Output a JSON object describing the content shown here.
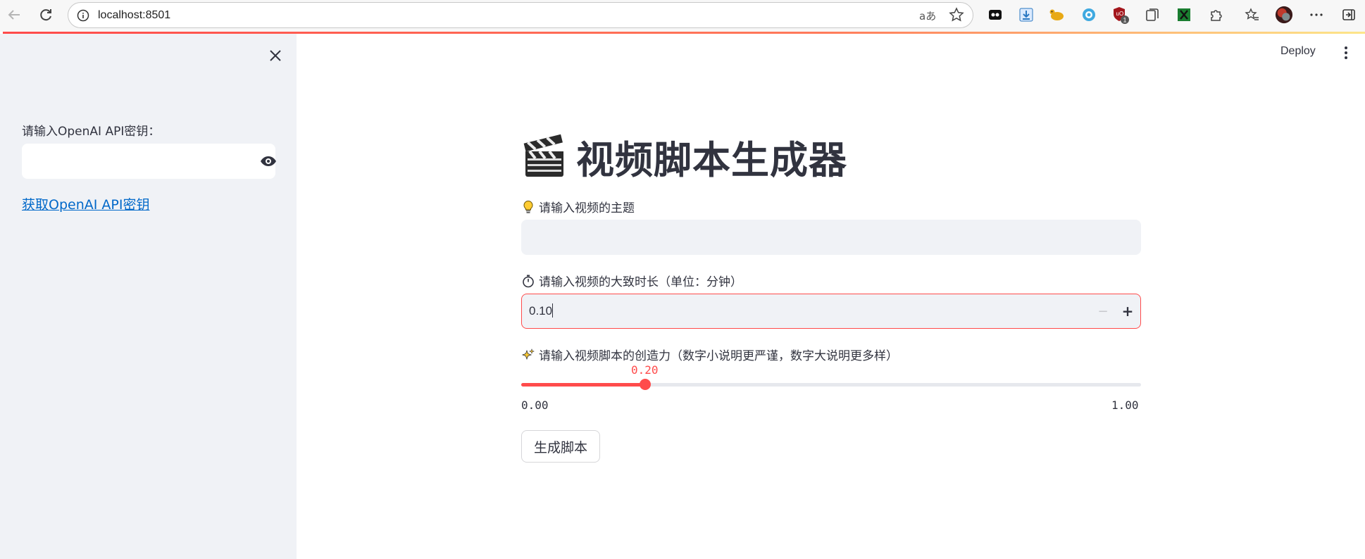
{
  "browser": {
    "url": "localhost:8501",
    "ext_badge": "1"
  },
  "sidebar": {
    "api_key_label": "请输入OpenAI API密钥：",
    "api_key_value": "",
    "get_key_link": "获取OpenAI API密钥"
  },
  "header": {
    "deploy_label": "Deploy"
  },
  "main": {
    "title": "视频脚本生成器",
    "subject": {
      "label": "请输入视频的主题",
      "value": ""
    },
    "duration": {
      "label": "请输入视频的大致时长（单位：分钟）",
      "value": "0.10",
      "minus": "−",
      "plus": "+"
    },
    "creativity": {
      "label": "请输入视频脚本的创造力（数字小说明更严谨，数字大说明更多样）",
      "value": 0.2,
      "value_label": "0.20",
      "min_label": "0.00",
      "max_label": "1.00",
      "min": 0,
      "max": 1
    },
    "generate_button": "生成脚本"
  },
  "colors": {
    "accent": "#ff4b4b",
    "sidebar_bg": "#f0f2f6",
    "link": "#0068c9"
  }
}
